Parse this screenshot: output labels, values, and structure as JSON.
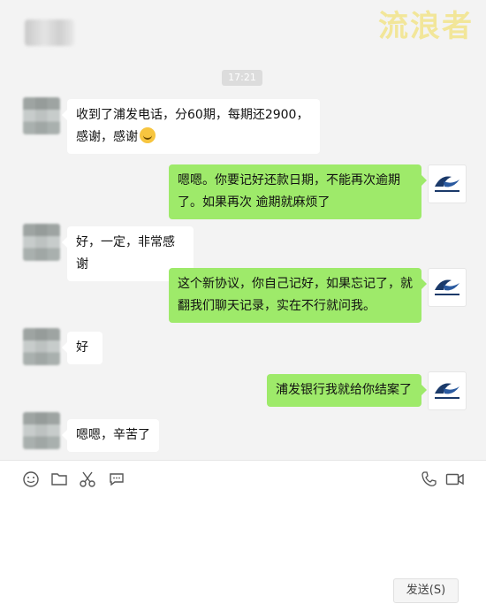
{
  "watermark": "流浪者",
  "timestamp": "17:21",
  "messages": [
    {
      "side": "left",
      "text": "收到了浦发电话，分60期，每期还2900，感谢，感谢"
    },
    {
      "side": "right",
      "text": "嗯嗯。你要记好还款日期，不能再次逾期了。如果再次 逾期就麻烦了"
    },
    {
      "side": "left",
      "text": "好，一定，非常感谢"
    },
    {
      "side": "right",
      "text": "这个新协议，你自己记好，如果忘记了，就翻我们聊天记录，实在不行就问我。"
    },
    {
      "side": "left",
      "text": "好"
    },
    {
      "side": "right",
      "text": "浦发银行我就给你结案了"
    },
    {
      "side": "left",
      "text": "嗯嗯，辛苦了"
    }
  ],
  "toolbar": {
    "icons": [
      "emoji-icon",
      "folder-icon",
      "scissors-icon",
      "chat-bubble-icon",
      "phone-icon",
      "video-icon"
    ]
  },
  "send_label": "发送(S)"
}
